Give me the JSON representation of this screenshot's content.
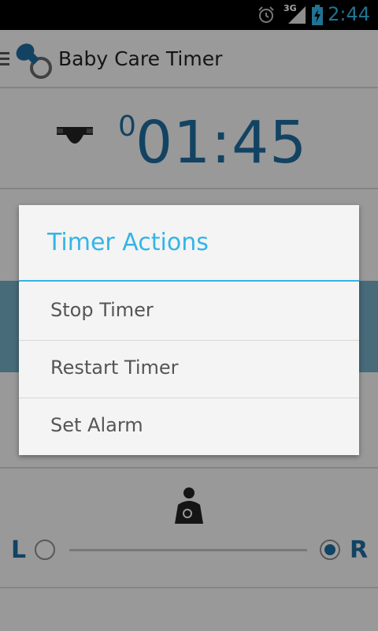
{
  "status_bar": {
    "time": "2:44",
    "network": "3G",
    "icons": [
      "alarm-icon",
      "signal-icon",
      "battery-charging-icon"
    ]
  },
  "action_bar": {
    "title": "Baby Care Timer",
    "icons": [
      "menu-icon",
      "pacifier-icon"
    ]
  },
  "timer": {
    "prefix": "0",
    "value": "01:45",
    "icon": "diaper-icon"
  },
  "feeding": {
    "icon": "breastfeeding-icon",
    "left_label": "L",
    "right_label": "R",
    "selected_side": "R"
  },
  "dialog": {
    "title": "Timer Actions",
    "items": [
      "Stop Timer",
      "Restart Timer",
      "Set Alarm"
    ]
  },
  "colors": {
    "accent": "#33b5e5",
    "timer_blue": "#1e6a9a",
    "band_blue": "#6fa8bd"
  }
}
